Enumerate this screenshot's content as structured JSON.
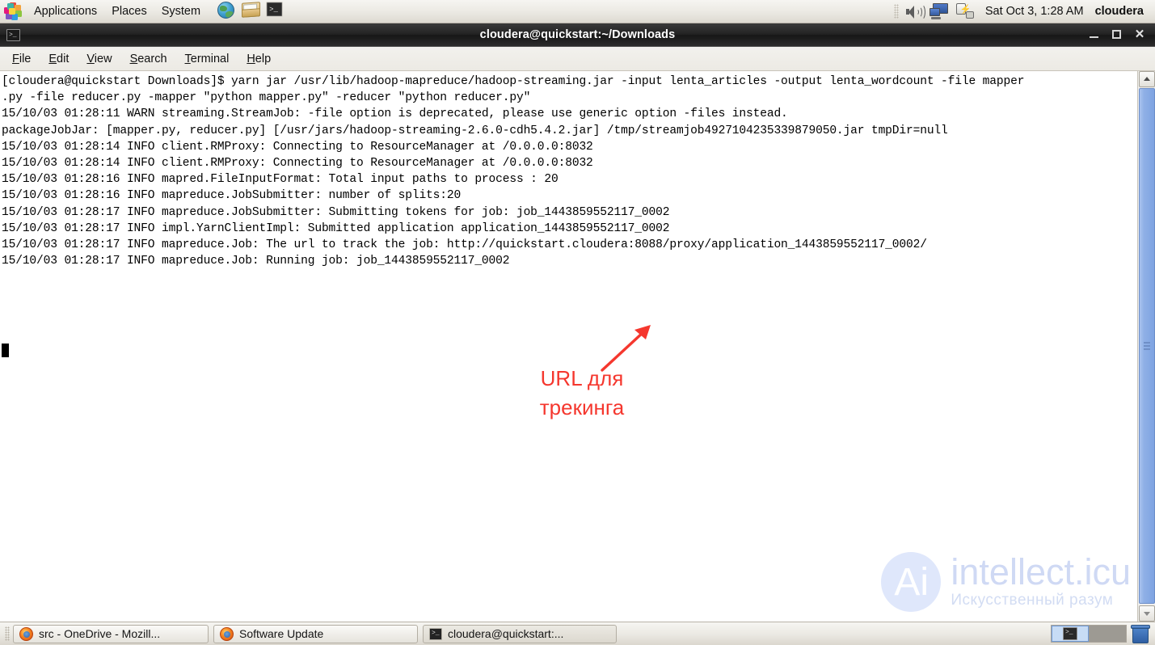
{
  "top_panel": {
    "menus": [
      {
        "label": "Applications",
        "name": "menu-applications"
      },
      {
        "label": "Places",
        "name": "menu-places"
      },
      {
        "label": "System",
        "name": "menu-system"
      }
    ],
    "launchers": [
      {
        "name": "web-browser-icon",
        "icon": "globe-icon"
      },
      {
        "name": "email-client-icon",
        "icon": "mail-icon"
      },
      {
        "name": "terminal-launcher-icon",
        "icon": "terminal-icon"
      }
    ],
    "tray": {
      "volume_icon": "speaker-icon",
      "network_icon": "monitor-network-icon",
      "battery_icon": "battery-icon"
    },
    "clock": "Sat Oct  3,  1:28 AM",
    "user": "cloudera"
  },
  "window": {
    "title": "cloudera@quickstart:~/Downloads",
    "icon": "terminal-icon",
    "buttons": {
      "minimize": "–",
      "maximize": "□",
      "close": "✕"
    },
    "menu": [
      {
        "accel": "F",
        "rest": "ile",
        "name": "menu-file"
      },
      {
        "accel": "E",
        "rest": "dit",
        "name": "menu-edit"
      },
      {
        "accel": "V",
        "rest": "iew",
        "name": "menu-view"
      },
      {
        "accel": "S",
        "rest": "earch",
        "name": "menu-search"
      },
      {
        "accel": "T",
        "rest": "erminal",
        "name": "menu-terminal"
      },
      {
        "accel": "H",
        "rest": "elp",
        "name": "menu-help"
      }
    ]
  },
  "terminal": {
    "lines": [
      "[cloudera@quickstart Downloads]$ yarn jar /usr/lib/hadoop-mapreduce/hadoop-streaming.jar -input lenta_articles -output lenta_wordcount -file mapper",
      ".py -file reducer.py -mapper \"python mapper.py\" -reducer \"python reducer.py\"",
      "15/10/03 01:28:11 WARN streaming.StreamJob: -file option is deprecated, please use generic option -files instead.",
      "packageJobJar: [mapper.py, reducer.py] [/usr/jars/hadoop-streaming-2.6.0-cdh5.4.2.jar] /tmp/streamjob4927104235339879050.jar tmpDir=null",
      "15/10/03 01:28:14 INFO client.RMProxy: Connecting to ResourceManager at /0.0.0.0:8032",
      "15/10/03 01:28:14 INFO client.RMProxy: Connecting to ResourceManager at /0.0.0.0:8032",
      "15/10/03 01:28:16 INFO mapred.FileInputFormat: Total input paths to process : 20",
      "15/10/03 01:28:16 INFO mapreduce.JobSubmitter: number of splits:20",
      "15/10/03 01:28:17 INFO mapreduce.JobSubmitter: Submitting tokens for job: job_1443859552117_0002",
      "15/10/03 01:28:17 INFO impl.YarnClientImpl: Submitted application application_1443859552117_0002",
      "15/10/03 01:28:17 INFO mapreduce.Job: The url to track the job: http://quickstart.cloudera:8088/proxy/application_1443859552117_0002/",
      "15/10/03 01:28:17 INFO mapreduce.Job: Running job: job_1443859552117_0002"
    ],
    "cursor": "block"
  },
  "annotation": {
    "text_line1": "URL для",
    "text_line2": "трекинга",
    "color": "#f5372e",
    "arrow": "arrow-up-right"
  },
  "watermark": {
    "logo_letters": "Ai",
    "title": "intellect.icu",
    "subtitle": "Искусственный  разум",
    "color": "#cfd9f4"
  },
  "taskbar": {
    "items": [
      {
        "label": "src - OneDrive - Mozill...",
        "icon": "firefox-icon",
        "name": "task-button-firefox-onedrive"
      },
      {
        "label": "Software Update",
        "icon": "firefox-icon",
        "name": "task-button-software-update"
      },
      {
        "label": "cloudera@quickstart:...",
        "icon": "terminal-icon",
        "name": "task-button-terminal"
      }
    ],
    "workspaces": [
      {
        "name": "workspace-1",
        "active": true
      },
      {
        "name": "workspace-2",
        "active": false
      }
    ],
    "trash": "trash-icon"
  },
  "colors": {
    "panel_bg": "#eceae4",
    "titlebar_bg": "#232323",
    "terminal_bg": "#ffffff",
    "terminal_fg": "#000000",
    "annotation": "#f5372e",
    "scrollbar_thumb": "#8fb0e6"
  }
}
